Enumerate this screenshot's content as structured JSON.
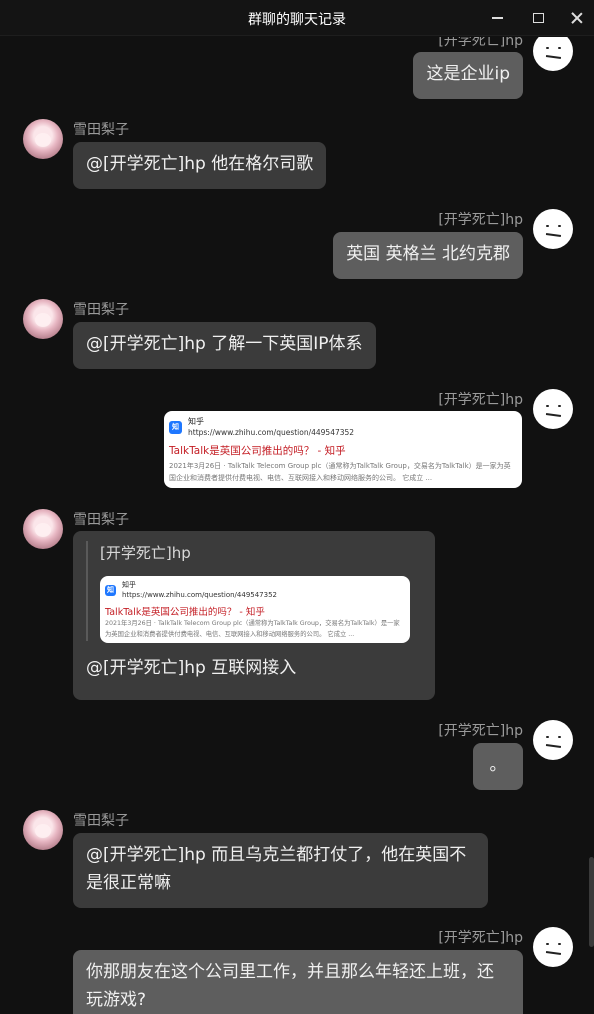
{
  "window": {
    "title": "群聊的聊天记录"
  },
  "users": {
    "me": "[开学死亡]hp",
    "other": "雪田梨子"
  },
  "messages": {
    "m1": "这是企业ip",
    "m2": "@[开学死亡]hp 他在格尔司歌",
    "m3": "英国 英格兰 北约克郡",
    "m4": "@[开学死亡]hp 了解一下英国IP体系",
    "m6_reply": "@[开学死亡]hp 互联网接入",
    "m7": "。",
    "m8": "@[开学死亡]hp 而且乌克兰都打仗了，他在英国不是很正常嘛",
    "m9": "你那朋友在这个公司里工作，并且那么年轻还上班，还玩游戏?"
  },
  "link_card": {
    "site": "知乎",
    "url": "https://www.zhihu.com/question/449547352",
    "title": "TalkTalk是英国公司推出的吗？ - 知乎",
    "desc": "2021年3月26日 · TalkTalk Telecom Group plc（通常称为TalkTalk Group，交易名为TalkTalk）是一家为英国企业和消费者提供付费电视、电信、互联网接入和移动网络服务的公司。 它成立 ..."
  },
  "icons": {
    "minimize": "minimize-icon",
    "maximize": "maximize-icon",
    "close": "close-icon"
  }
}
